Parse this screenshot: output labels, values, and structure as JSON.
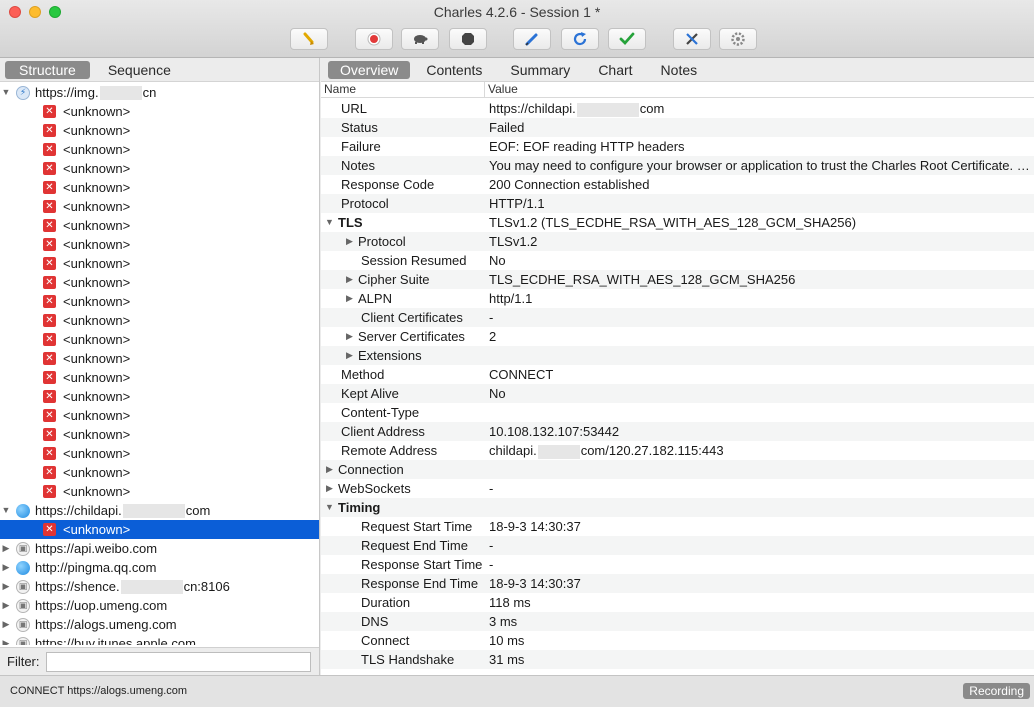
{
  "window": {
    "title": "Charles 4.2.6 - Session 1 *"
  },
  "toolbar": {
    "buttons": [
      {
        "icon": "broom-icon",
        "color": "#e2a800"
      },
      {
        "icon": "record-icon",
        "color": "#e23a3a"
      },
      {
        "icon": "turtle-icon",
        "color": "#555555"
      },
      {
        "icon": "stop-icon",
        "color": "#444444"
      },
      {
        "icon": "pen-icon",
        "color": "#2b73d6"
      },
      {
        "icon": "refresh-icon",
        "color": "#2b73d6"
      },
      {
        "icon": "checkmark-icon",
        "color": "#25a23a"
      },
      {
        "icon": "tools-icon",
        "color": "#444444"
      },
      {
        "icon": "gear-icon",
        "color": "#777777"
      }
    ]
  },
  "left_tabs": {
    "structure": "Structure",
    "sequence": "Sequence"
  },
  "tree": {
    "host1": {
      "prefix": "https://img.",
      "suffix": "cn"
    },
    "unknown_label": "<unknown>",
    "host2": {
      "prefix": "https://childapi.",
      "suffix": "com"
    },
    "hosts": [
      {
        "label": "https://api.weibo.com",
        "icon": "lock-icon"
      },
      {
        "label": "http://pingma.qq.com",
        "icon": "globe-icon"
      },
      {
        "label_prefix": "https://shence.",
        "label_suffix": "cn:8106",
        "icon": "lock-icon"
      },
      {
        "label": "https://uop.umeng.com",
        "icon": "lock-icon"
      },
      {
        "label": "https://alogs.umeng.com",
        "icon": "lock-icon"
      },
      {
        "label": "https://buy.itunes.apple.com",
        "icon": "lock-icon"
      }
    ]
  },
  "filter": {
    "label": "Filter:",
    "value": ""
  },
  "right_tabs": {
    "overview": "Overview",
    "contents": "Contents",
    "summary": "Summary",
    "chart": "Chart",
    "notes": "Notes"
  },
  "columns": {
    "name": "Name",
    "value": "Value"
  },
  "overview": {
    "url_name": "URL",
    "url_prefix": "https://childapi.",
    "url_suffix": "com",
    "status_name": "Status",
    "status_value": "Failed",
    "failure_name": "Failure",
    "failure_value": "EOF: EOF reading HTTP headers",
    "notes_name": "Notes",
    "notes_value": "You may need to configure your browser or application to trust the Charles Root Certificate. Se...",
    "response_code_name": "Response Code",
    "response_code_value": "200 Connection established",
    "protocol_name": "Protocol",
    "protocol_value": "HTTP/1.1",
    "tls_name": "TLS",
    "tls_value": "TLSv1.2 (TLS_ECDHE_RSA_WITH_AES_128_GCM_SHA256)",
    "tls_protocol_name": "Protocol",
    "tls_protocol_value": "TLSv1.2",
    "session_resumed_name": "Session Resumed",
    "session_resumed_value": "No",
    "cipher_suite_name": "Cipher Suite",
    "cipher_suite_value": "TLS_ECDHE_RSA_WITH_AES_128_GCM_SHA256",
    "alpn_name": "ALPN",
    "alpn_value": "http/1.1",
    "client_certs_name": "Client Certificates",
    "client_certs_value": "-",
    "server_certs_name": "Server Certificates",
    "server_certs_value": "2",
    "extensions_name": "Extensions",
    "extensions_value": "",
    "method_name": "Method",
    "method_value": "CONNECT",
    "kept_alive_name": "Kept Alive",
    "kept_alive_value": "No",
    "content_type_name": "Content-Type",
    "content_type_value": "",
    "client_address_name": "Client Address",
    "client_address_value": "10.108.132.107:53442",
    "remote_address_name": "Remote Address",
    "remote_prefix": "childapi.",
    "remote_suffix": "com/120.27.182.115:443",
    "connection_name": "Connection",
    "connection_value": "",
    "websockets_name": "WebSockets",
    "websockets_value": "-",
    "timing_name": "Timing",
    "timing_value": "",
    "req_start_name": "Request Start Time",
    "req_start_value": "18-9-3 14:30:37",
    "req_end_name": "Request End Time",
    "req_end_value": "-",
    "resp_start_name": "Response Start Time",
    "resp_start_value": "-",
    "resp_end_name": "Response End Time",
    "resp_end_value": "18-9-3 14:30:37",
    "duration_name": "Duration",
    "duration_value": "118 ms",
    "dns_name": "DNS",
    "dns_value": "3 ms",
    "connect_name": "Connect",
    "connect_value": "10 ms",
    "tls_handshake_name": "TLS Handshake",
    "tls_handshake_value": "31 ms"
  },
  "statusbar": {
    "text": "CONNECT https://alogs.umeng.com",
    "recording": "Recording"
  }
}
